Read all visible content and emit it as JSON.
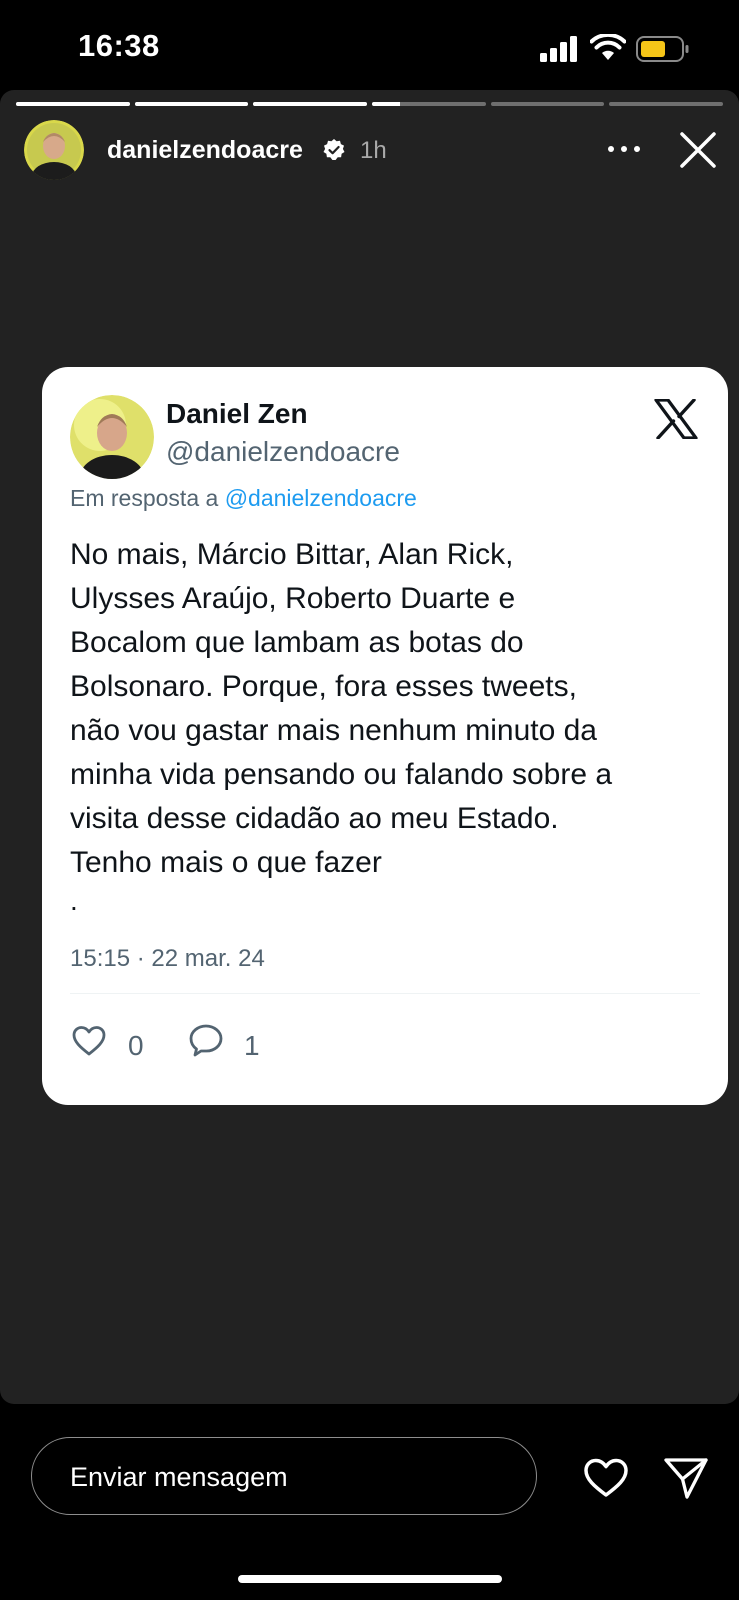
{
  "status_bar": {
    "time": "16:38"
  },
  "story": {
    "progress_segments": [
      1,
      1,
      1,
      0.25,
      0,
      0
    ],
    "username": "danielzendoacre",
    "time_ago": "1h"
  },
  "tweet": {
    "name": "Daniel Zen",
    "handle": "@danielzendoacre",
    "reply_prefix": "Em resposta a ",
    "reply_mention": "@danielzendoacre",
    "text": "No mais, Márcio Bittar, Alan Rick,\nUlysses Araújo, Roberto Duarte e\nBocalom que lambam as botas do\nBolsonaro. Porque, fora esses tweets,\nnão vou gastar mais nenhum minuto da\nminha vida pensando ou falando sobre a\nvisita desse cidadão ao meu Estado.\nTenho mais o que fazer",
    "trailing": ".",
    "date": "15:15 · 22 mar. 24",
    "likes": "0",
    "replies": "1"
  },
  "footer": {
    "message_placeholder": "Enviar mensagem"
  },
  "colors": {
    "story_bg": "#222222",
    "mention": "#1d9bf0",
    "battery": "#f5c518"
  }
}
